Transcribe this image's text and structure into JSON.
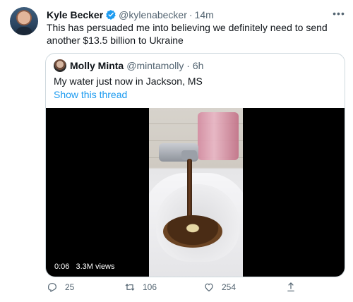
{
  "tweet": {
    "author": {
      "name": "Kyle Becker",
      "handle": "@kylenabecker",
      "time": "14m"
    },
    "text": "This has persuaded me into believing we definitely need to send another $13.5 billion to Ukraine",
    "quoted": {
      "author": {
        "name": "Molly Minta",
        "handle": "@mintamolly",
        "time": "6h"
      },
      "text": "My water just now in Jackson, MS",
      "show_thread": "Show this thread",
      "video": {
        "duration": "0:06",
        "views": "3.3M views"
      }
    },
    "actions": {
      "replies": "25",
      "retweets": "106",
      "likes": "254"
    },
    "colors": {
      "accent": "#1d9bf0",
      "muted": "#536471",
      "verified": "#1d9bf0"
    },
    "icons": {
      "more": "more-horizontal-icon",
      "verified": "verified-badge-icon"
    }
  }
}
